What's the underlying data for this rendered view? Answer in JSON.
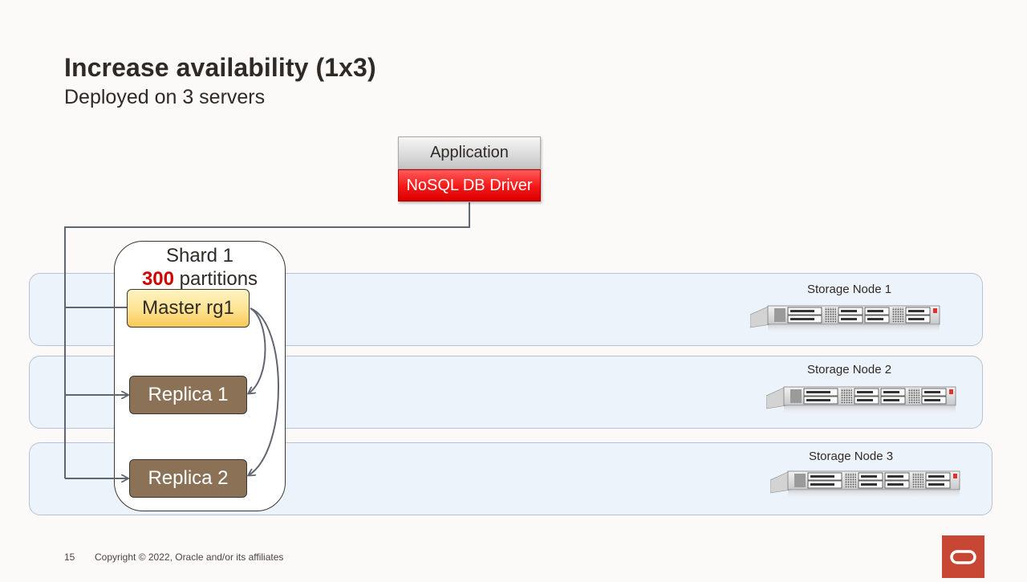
{
  "slide": {
    "title": "Increase availability (1x3)",
    "subtitle": "Deployed on 3 servers"
  },
  "application": {
    "app_label": "Application",
    "driver_label": "NoSQL DB Driver"
  },
  "shard": {
    "title": "Shard  1",
    "partition_count": "300",
    "partition_word": " partitions",
    "master_label": "Master rg1",
    "replica1_label": "Replica 1",
    "replica2_label": "Replica 2"
  },
  "storage_nodes": [
    {
      "label": "Storage Node 1"
    },
    {
      "label": "Storage Node 2"
    },
    {
      "label": "Storage Node 3"
    }
  ],
  "footer": {
    "page_number": "15",
    "copyright": "Copyright © 2022, Oracle and/or its affiliates"
  },
  "colors": {
    "partition_count": "#d10000",
    "driver_red": "#f51717",
    "replica_brown": "#8b7257",
    "master_yellow": "#fde28f",
    "lane_blue": "#edf3fb",
    "oracle_red": "#c74634"
  }
}
